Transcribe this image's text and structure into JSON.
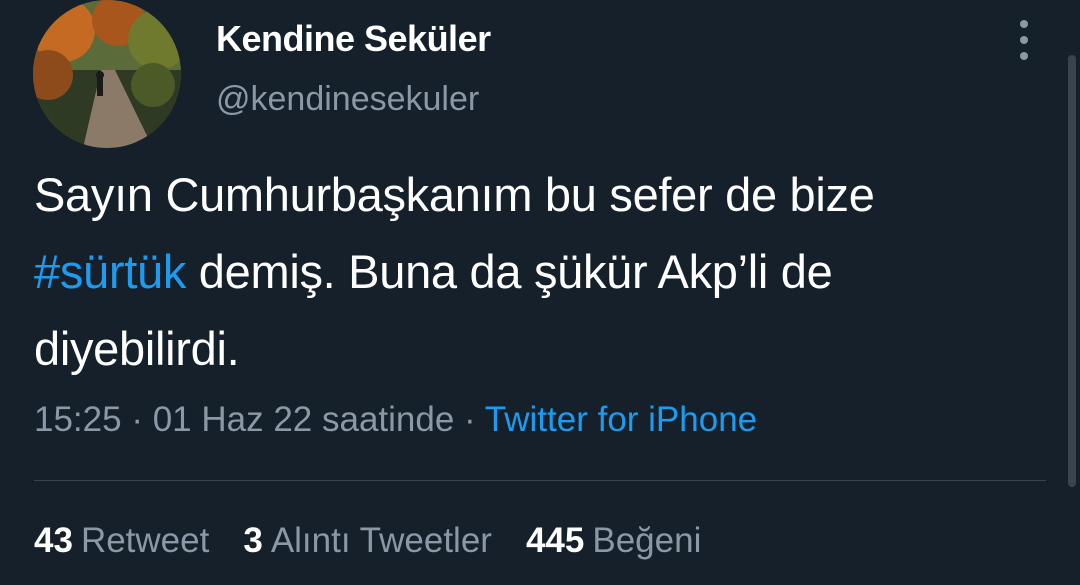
{
  "user": {
    "display_name": "Kendine Seküler",
    "handle": "@kendinesekuler"
  },
  "tweet": {
    "text_before": "Sayın Cumhurbaşkanım bu sefer de bize ",
    "hashtag": "#sürtük",
    "text_after": " demiş. Buna da şükür Akp’li de diyebilirdi."
  },
  "meta": {
    "time": "15:25",
    "separator": " · ",
    "date": "01 Haz 22 saatinde",
    "separator2": " · ",
    "source": "Twitter for iPhone"
  },
  "stats": [
    {
      "count": "43",
      "label": "Retweet"
    },
    {
      "count": "3",
      "label": "Alıntı Tweetler"
    },
    {
      "count": "445",
      "label": "Beğeni"
    }
  ],
  "icons": {
    "more": "more-vertical-icon"
  },
  "colors": {
    "background": "#15202b",
    "accent": "#1d9bf0",
    "secondary_text": "#8b98a5"
  }
}
